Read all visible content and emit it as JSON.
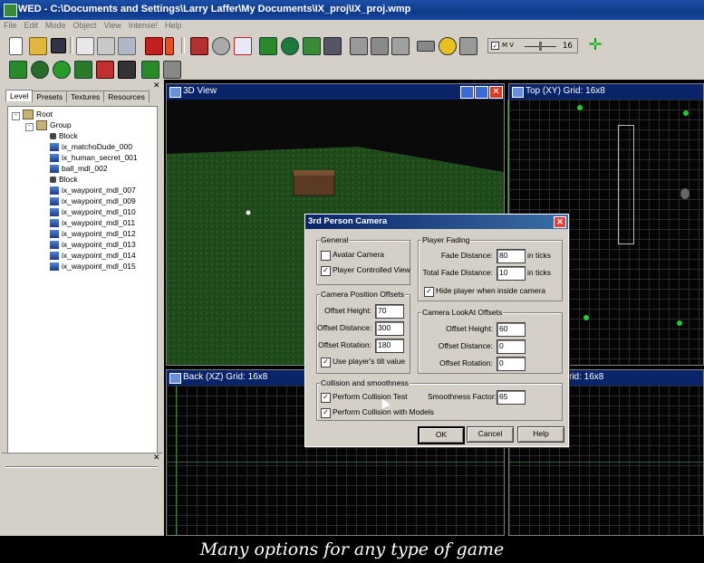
{
  "window": {
    "title": "WED - C:\\Documents and Settings\\Larry Laffer\\My Documents\\IX_proj\\IX_proj.wmp"
  },
  "menu": [
    "File",
    "Edit",
    "Mode",
    "Object",
    "View",
    "Intense!",
    "Help"
  ],
  "toolbar": {
    "zoom_value": "16"
  },
  "left_panel": {
    "tabs": [
      "Level",
      "Presets",
      "Textures",
      "Resources"
    ],
    "tree": [
      {
        "label": "Root",
        "icon": "folder-icon",
        "depth": 0,
        "expander": "-"
      },
      {
        "label": "Group",
        "icon": "group-icon",
        "depth": 1,
        "expander": "-"
      },
      {
        "label": "Block",
        "icon": "block-icon",
        "depth": 2
      },
      {
        "label": "ix_matchoDude_000",
        "icon": "model-icon",
        "depth": 2
      },
      {
        "label": "ix_human_secret_001",
        "icon": "model-icon",
        "depth": 2
      },
      {
        "label": "ball_mdl_002",
        "icon": "model-icon",
        "depth": 2
      },
      {
        "label": "Block",
        "icon": "block-icon",
        "depth": 2
      },
      {
        "label": "ix_waypoint_mdl_007",
        "icon": "model-icon",
        "depth": 2
      },
      {
        "label": "ix_waypoint_mdl_009",
        "icon": "model-icon",
        "depth": 2
      },
      {
        "label": "ix_waypoint_mdl_010",
        "icon": "model-icon",
        "depth": 2
      },
      {
        "label": "ix_waypoint_mdl_011",
        "icon": "model-icon",
        "depth": 2
      },
      {
        "label": "ix_waypoint_mdl_012",
        "icon": "model-icon",
        "depth": 2
      },
      {
        "label": "ix_waypoint_mdl_013",
        "icon": "model-icon",
        "depth": 2
      },
      {
        "label": "ix_waypoint_mdl_014",
        "icon": "model-icon",
        "depth": 2
      },
      {
        "label": "ix_waypoint_mdl_015",
        "icon": "model-icon",
        "depth": 2
      }
    ]
  },
  "viewports": {
    "view3d": "3D View",
    "top": "Top (XY) Grid: 16x8",
    "back": "Back (XZ) Grid: 16x8",
    "side": "rid: 16x8"
  },
  "dialog": {
    "title": "3rd Person Camera",
    "general": {
      "title": "General",
      "avatar_camera": "Avatar Camera",
      "avatar_checked": false,
      "player_controlled": "Player Controlled View",
      "player_checked": true
    },
    "fading": {
      "title": "Player Fading",
      "fade_distance_label": "Fade Distance:",
      "fade_distance": "80",
      "fade_unit": "in ticks",
      "total_fade_label": "Total Fade Distance:",
      "total_fade": "10",
      "total_unit": "in ticks",
      "hide_player": "Hide player when inside camera",
      "hide_checked": true
    },
    "position": {
      "title": "Camera Position Offsets",
      "height_label": "Offset Height:",
      "height": "70",
      "distance_label": "Offset Distance:",
      "distance": "300",
      "rotation_label": "Offset Rotation:",
      "rotation": "180",
      "tilt": "Use player's tilt value",
      "tilt_checked": true
    },
    "lookat": {
      "title": "Camera LookAt Offsets",
      "height_label": "Offset Height:",
      "height": "60",
      "distance_label": "Offset Distance:",
      "distance": "0",
      "rotation_label": "Offset Rotation:",
      "rotation": "0"
    },
    "collision": {
      "title": "Collision and smoothness",
      "test": "Perform Collision Test",
      "test_checked": true,
      "models": "Perform Collision with Models",
      "models_checked": true,
      "smooth_label": "Smoothness Factor:",
      "smooth": "65"
    },
    "buttons": {
      "ok": "OK",
      "cancel": "Cancel",
      "help": "Help"
    }
  },
  "caption": "Many options for any type of game",
  "colors": {
    "titlebar": "#0a246a",
    "panel": "#d4d0c8",
    "grass": "#1d4a1a",
    "sky": "#0a0a0a",
    "waypoint": "#22cc33"
  }
}
